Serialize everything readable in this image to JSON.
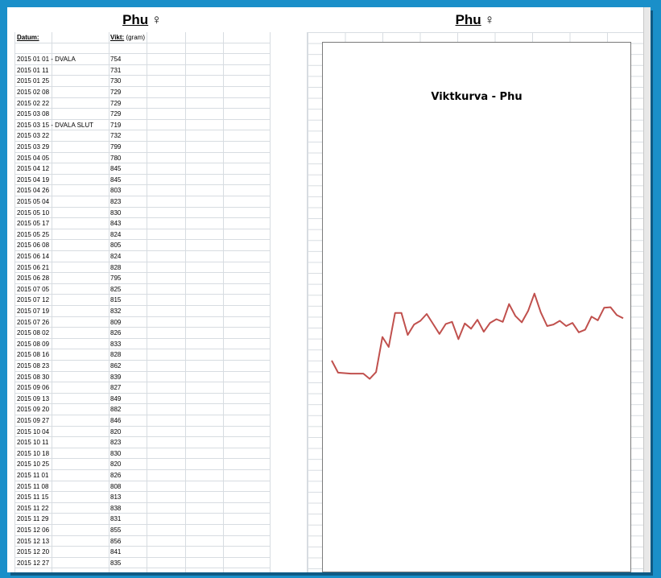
{
  "left_title": {
    "name": "Phu",
    "symbol": "♀"
  },
  "right_title": {
    "name": "Phu",
    "symbol": "♀"
  },
  "table": {
    "header_date": "Datum:",
    "header_weight": "Vikt:",
    "header_unit": "(gram)",
    "rows": [
      {
        "date": "2015 01 01 - DVALA",
        "weight": "754"
      },
      {
        "date": "2015 01 11",
        "weight": "731"
      },
      {
        "date": "2015 01 25",
        "weight": "730"
      },
      {
        "date": "2015 02 08",
        "weight": "729"
      },
      {
        "date": "2015 02 22",
        "weight": "729"
      },
      {
        "date": "2015 03 08",
        "weight": "729"
      },
      {
        "date": "2015 03 15 - DVALA SLUT",
        "weight": "719"
      },
      {
        "date": "2015 03 22",
        "weight": "732"
      },
      {
        "date": "2015 03 29",
        "weight": "799"
      },
      {
        "date": "2015 04 05",
        "weight": "780"
      },
      {
        "date": "2015 04 12",
        "weight": "845"
      },
      {
        "date": "2015 04 19",
        "weight": "845"
      },
      {
        "date": "2015 04 26",
        "weight": "803"
      },
      {
        "date": "2015 05 04",
        "weight": "823"
      },
      {
        "date": "2015 05 10",
        "weight": "830"
      },
      {
        "date": "2015 05 17",
        "weight": "843"
      },
      {
        "date": "2015 05 25",
        "weight": "824"
      },
      {
        "date": "2015 06 08",
        "weight": "805"
      },
      {
        "date": "2015 06 14",
        "weight": "824"
      },
      {
        "date": "2015 06 21",
        "weight": "828"
      },
      {
        "date": "2015 06 28",
        "weight": "795"
      },
      {
        "date": "2015 07 05",
        "weight": "825"
      },
      {
        "date": "2015 07 12",
        "weight": "815"
      },
      {
        "date": "2015 07 19",
        "weight": "832"
      },
      {
        "date": "2015 07 26",
        "weight": "809"
      },
      {
        "date": "2015 08 02",
        "weight": "826"
      },
      {
        "date": "2015 08 09",
        "weight": "833"
      },
      {
        "date": "2015 08 16",
        "weight": "828"
      },
      {
        "date": "2015 08 23",
        "weight": "862"
      },
      {
        "date": "2015 08 30",
        "weight": "839"
      },
      {
        "date": "2015 09 06",
        "weight": "827"
      },
      {
        "date": "2015 09 13",
        "weight": "849"
      },
      {
        "date": "2015 09 20",
        "weight": "882"
      },
      {
        "date": "2015 09 27",
        "weight": "846"
      },
      {
        "date": "2015 10 04",
        "weight": "820"
      },
      {
        "date": "2015 10 11",
        "weight": "823"
      },
      {
        "date": "2015 10 18",
        "weight": "830"
      },
      {
        "date": "2015 10 25",
        "weight": "820"
      },
      {
        "date": "2015 11 01",
        "weight": "826"
      },
      {
        "date": "2015 11 08",
        "weight": "808"
      },
      {
        "date": "2015 11 15",
        "weight": "813"
      },
      {
        "date": "2015 11 22",
        "weight": "838"
      },
      {
        "date": "2015 11 29",
        "weight": "831"
      },
      {
        "date": "2015 12 06",
        "weight": "855"
      },
      {
        "date": "2015 12 13",
        "weight": "856"
      },
      {
        "date": "2015 12 20",
        "weight": "841"
      },
      {
        "date": "2015 12 27",
        "weight": "835"
      }
    ]
  },
  "chart_data": {
    "type": "line",
    "title": "Viktkurva - Phu",
    "xlabel": "",
    "ylabel": "",
    "grid": false,
    "legend": "none",
    "ylim": [
      500,
      1300
    ],
    "series": [
      {
        "color": "#c0504d",
        "values": [
          754,
          731,
          730,
          729,
          729,
          729,
          719,
          732,
          799,
          780,
          845,
          845,
          803,
          823,
          830,
          843,
          824,
          805,
          824,
          828,
          795,
          825,
          815,
          832,
          809,
          826,
          833,
          828,
          862,
          839,
          827,
          849,
          882,
          846,
          820,
          823,
          830,
          820,
          826,
          808,
          813,
          838,
          831,
          855,
          856,
          841,
          835
        ]
      }
    ]
  }
}
